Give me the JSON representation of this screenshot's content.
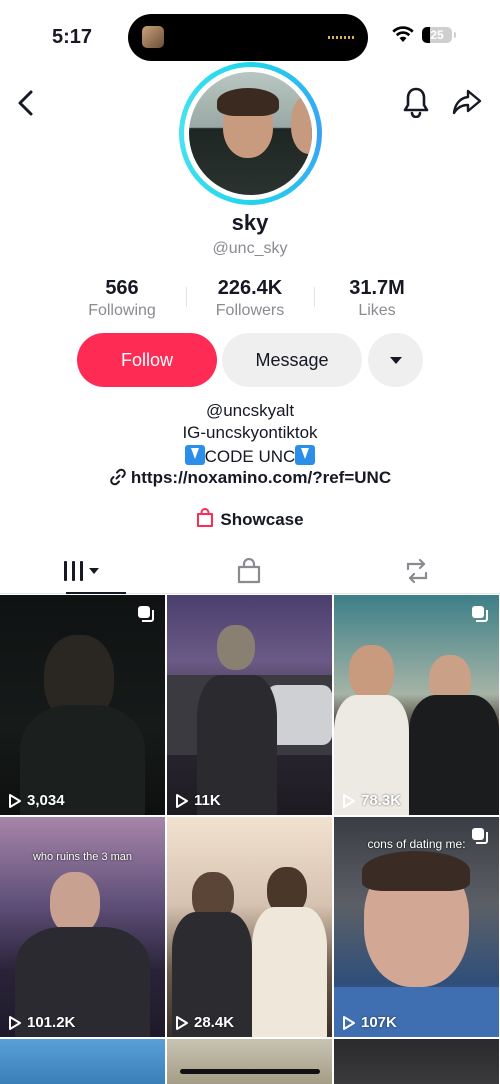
{
  "status_bar": {
    "time": "5:17",
    "battery": "25"
  },
  "profile": {
    "name": "sky",
    "handle": "@unc_sky",
    "stats": [
      {
        "value": "566",
        "label": "Following"
      },
      {
        "value": "226.4K",
        "label": "Followers"
      },
      {
        "value": "31.7M",
        "label": "Likes"
      }
    ],
    "buttons": {
      "follow": "Follow",
      "message": "Message"
    },
    "bio_lines": [
      "@uncskyalt",
      "IG-uncskyontiktok",
      "CODE UNC"
    ],
    "link": "https://noxamino.com/?ref=UNC",
    "showcase": "Showcase"
  },
  "tabs": [
    "videos-tab",
    "shop-tab",
    "reposts-tab"
  ],
  "videos": [
    {
      "views": "3,034",
      "caption": ""
    },
    {
      "views": "11K",
      "caption": ""
    },
    {
      "views": "78.3K",
      "caption": ""
    },
    {
      "views": "101.2K",
      "caption": "who ruins the 3 man"
    },
    {
      "views": "28.4K",
      "caption": ""
    },
    {
      "views": "107K",
      "caption": "cons of dating me:"
    }
  ],
  "colors": {
    "accent": "#fe2c55",
    "ring": "#20d5ec"
  }
}
